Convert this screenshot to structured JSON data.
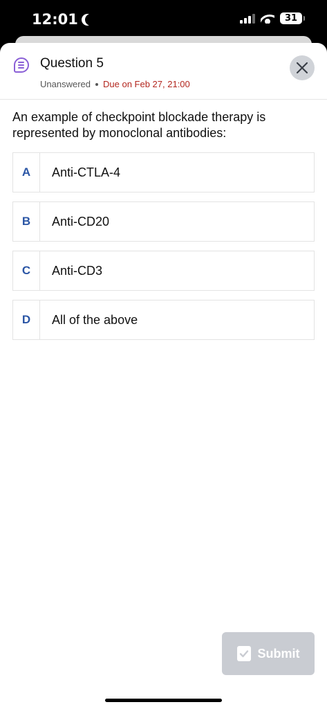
{
  "status_bar": {
    "time": "12:01",
    "battery": "31"
  },
  "header": {
    "title": "Question 5",
    "status": "Unanswered",
    "due": "Due on Feb 27, 21:00"
  },
  "question": {
    "text": "An example of checkpoint blockade therapy is represented by monoclonal antibodies:"
  },
  "options": [
    {
      "letter": "A",
      "text": "Anti-CTLA-4"
    },
    {
      "letter": "B",
      "text": "Anti-CD20"
    },
    {
      "letter": "C",
      "text": "Anti-CD3"
    },
    {
      "letter": "D",
      "text": "All of the above"
    }
  ],
  "submit": {
    "label": "Submit",
    "icon": "clipboard-check-icon"
  },
  "colors": {
    "accent_letter": "#2b56a5",
    "due_red": "#b3261e",
    "icon_purple": "#8a5fd6",
    "submit_disabled": "#c9ccd2"
  }
}
